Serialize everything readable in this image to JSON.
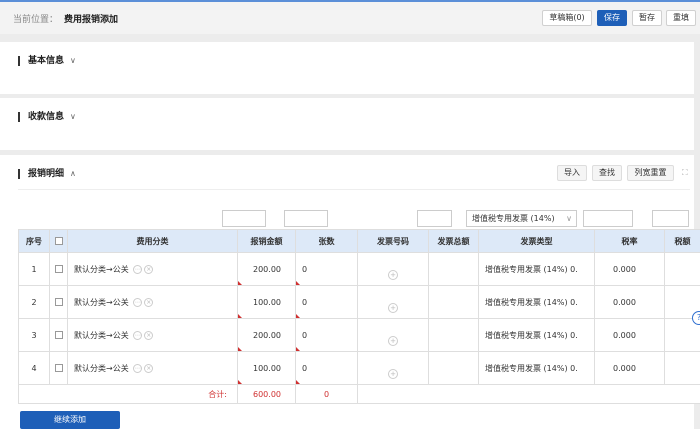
{
  "breadcrumb": {
    "label": "当前位置：",
    "current": "费用报销添加"
  },
  "toolbar": {
    "draft_box": "草稿箱(0)",
    "save": "保存",
    "temp_save": "暂存",
    "reset": "重填"
  },
  "sections": {
    "basic": {
      "title": "基本信息"
    },
    "payee": {
      "title": "收款信息"
    },
    "detail": {
      "title": "报销明细"
    }
  },
  "detail_actions": {
    "import": "导入",
    "search": "查找",
    "reset_width": "列宽重置"
  },
  "filter": {
    "invoice_type_value": "增值税专用发票 (14%)"
  },
  "table": {
    "headers": [
      "序号",
      "",
      "费用分类",
      "报销金额",
      "张数",
      "发票号码",
      "发票总额",
      "发票类型",
      "税率",
      "税额"
    ],
    "rows": [
      {
        "no": "1",
        "category": "默认分类→公关",
        "amount": "200.00",
        "count": "0",
        "invoice_type": "增值税专用发票 (14%) 0.",
        "tax_rate": "0.000"
      },
      {
        "no": "2",
        "category": "默认分类→公关",
        "amount": "100.00",
        "count": "0",
        "invoice_type": "增值税专用发票 (14%) 0.",
        "tax_rate": "0.000"
      },
      {
        "no": "3",
        "category": "默认分类→公关",
        "amount": "200.00",
        "count": "0",
        "invoice_type": "增值税专用发票 (14%) 0.",
        "tax_rate": "0.000"
      },
      {
        "no": "4",
        "category": "默认分类→公关",
        "amount": "100.00",
        "count": "0",
        "invoice_type": "增值税专用发票 (14%) 0.",
        "tax_rate": "0.000"
      }
    ],
    "total": {
      "label": "合计:",
      "amount": "600.00",
      "count": "0"
    }
  },
  "add_more": "继续添加"
}
